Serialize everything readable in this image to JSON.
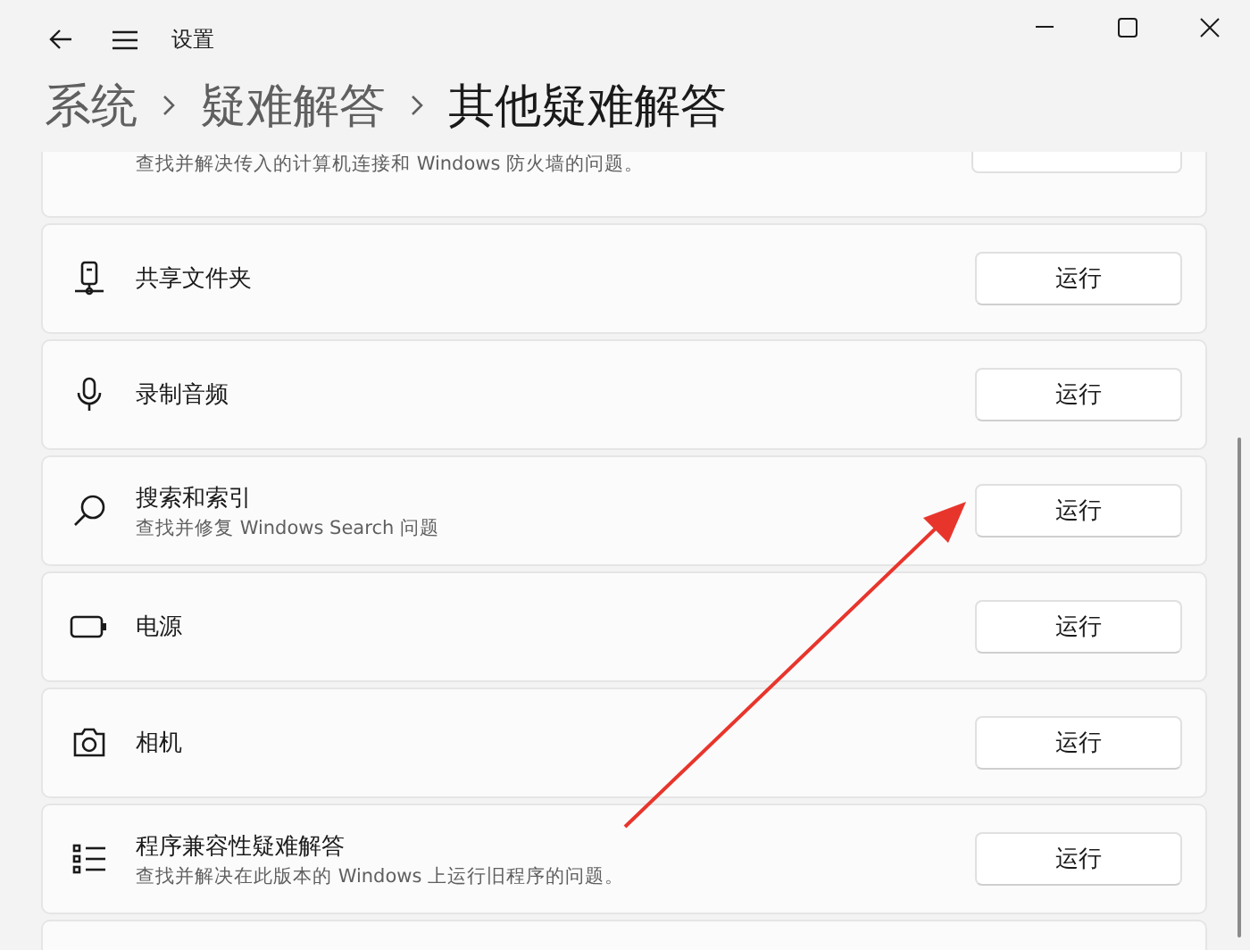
{
  "window": {
    "title": "设置"
  },
  "breadcrumb": [
    {
      "label": "系统",
      "selected": false
    },
    {
      "label": "疑难解答",
      "selected": false
    },
    {
      "label": "其他疑难解答",
      "selected": true
    }
  ],
  "items": [
    {
      "kind": "partial-top",
      "description": "查找并解决传入的计算机连接和 Windows 防火墙的问题。"
    },
    {
      "kind": "item",
      "title": "共享文件夹",
      "button": "运行"
    },
    {
      "kind": "item",
      "title": "录制音频",
      "button": "运行"
    },
    {
      "kind": "item",
      "title": "搜索和索引",
      "description": "查找并修复 Windows Search 问题",
      "button": "运行"
    },
    {
      "kind": "item",
      "title": "电源",
      "button": "运行"
    },
    {
      "kind": "item",
      "title": "相机",
      "button": "运行"
    },
    {
      "kind": "item",
      "title": "程序兼容性疑难解答",
      "description": "查找并解决在此版本的 Windows 上运行旧程序的问题。",
      "button": "运行"
    },
    {
      "kind": "partial-bottom"
    }
  ]
}
